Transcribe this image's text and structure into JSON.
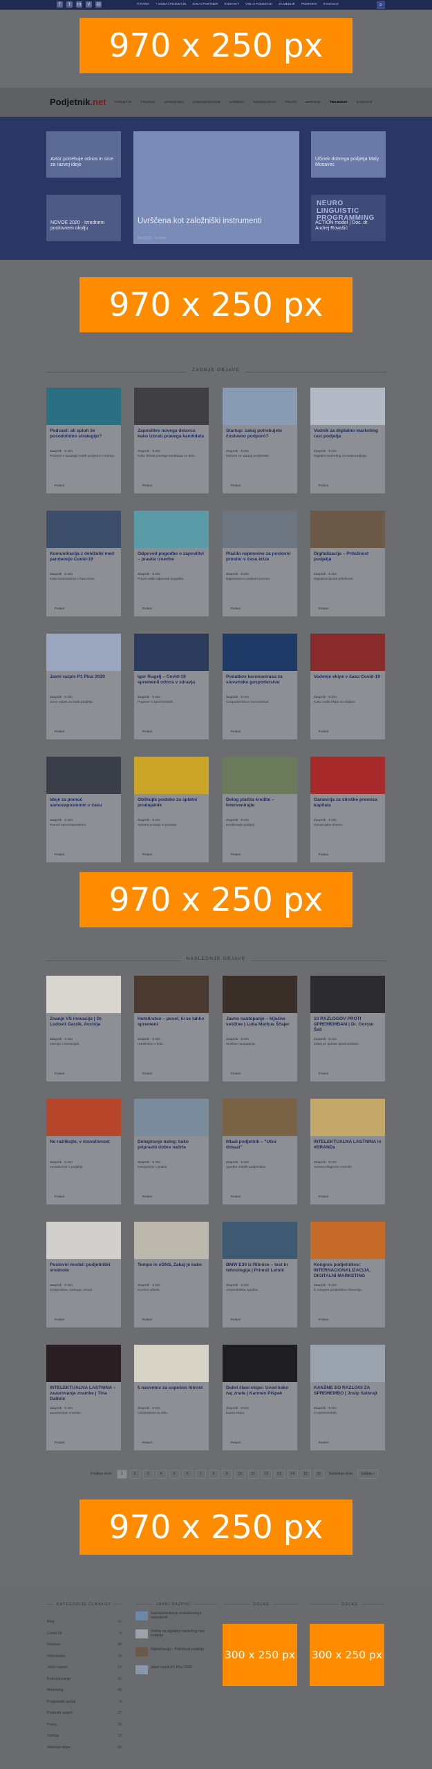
{
  "topbar": {
    "social_icons": [
      "facebook-icon",
      "twitter-icon",
      "linkedin-icon",
      "vimeo-icon",
      "rss-icon"
    ],
    "links": [
      "o nama",
      "+ dodaj podjetje",
      "zakaj partner",
      "kontakt",
      "vse o podjetju",
      "za medije",
      "podpora",
      "e-novice"
    ],
    "search_icon": "search-icon"
  },
  "ads": {
    "top": "970 x 250 px",
    "mid1": "970 x 250 px",
    "mid2": "970 x 250 px",
    "bottom": "970 x 250 px",
    "side1": "300 x 250 px",
    "side2": "300 x 250 px"
  },
  "nav": {
    "logo_main": "Podjetnik",
    "logo_suffix": ".net",
    "menu": [
      "Podjetje",
      "Finance",
      "Marketing",
      "Komuniciranje",
      "Kariera",
      "Tehnologija",
      "Pravo",
      "Zdravje",
      "Trajnost",
      "E-novice"
    ]
  },
  "featured": [
    {
      "title": "Avtor potrebuje odnos in srce za razvoj ideje",
      "meta": "",
      "thumb": "#5c6a96"
    },
    {
      "title": "Uvrščena kot založniški instrumenti",
      "meta": "Maj 2020 · 5 minut",
      "thumb": "#7a8bb8"
    },
    {
      "title": "Učinek dobrega podjetja Maly Mosavec",
      "meta": "",
      "thumb": "#6b7aa8"
    },
    {
      "title": "NOVOE 2020 · Izrednem poslovnem okolju",
      "meta": "",
      "thumb": "#4d5a86"
    },
    {
      "title": "ACTION model | Doc. dr. Andrej Rovašić",
      "meta": "",
      "neuro": "NEURO LINGUISTIC PROGRAMMING",
      "thumb": "#3e4a78"
    }
  ],
  "sections": {
    "latest": "Zadnje objave",
    "recommended": "Naslednje objave"
  },
  "cards_latest": [
    {
      "title": "Podcast: ali sploh še posodobimo strategijo?",
      "meta": "Zaupnik · 5 min",
      "excerpt": "Podcast o strategiji malih podjetij in vodenju.",
      "more": "Preberi",
      "thumb": "#2b6f82"
    },
    {
      "title": "Zaposlitev novega delavca kako izbrati pravega kandidata",
      "meta": "Zaupnik · 5 min",
      "excerpt": "Kako izbrati pravega kandidata za delo.",
      "more": "Preberi",
      "thumb": "#3f3f44"
    },
    {
      "title": "Startup: zakaj potrebujete čustveno podporo?",
      "meta": "Zaupnik · 5 min",
      "excerpt": "Nasveti za startup podjetnike.",
      "more": "Preberi",
      "thumb": "#8a9bb4"
    },
    {
      "title": "Vodnik za digitalno marketing rast podjetja",
      "meta": "Zaupnik · 5 min",
      "excerpt": "Digitalni marketing za mala podjetja.",
      "more": "Preberi",
      "thumb": "#b3bac6"
    },
    {
      "title": "Komunikacija z deležniki med pandemijo Covid-19",
      "meta": "Zaupnik · 5 min",
      "excerpt": "Kako komunicirati v času krize.",
      "more": "Preberi",
      "thumb": "#3d4e6b"
    },
    {
      "title": "Odpoved pogodbe o zaposlitvi – pravila izvedbe",
      "meta": "Zaupnik · 5 min",
      "excerpt": "Pravni vidiki odpovedi pogodbe.",
      "more": "Preberi",
      "thumb": "#5a9ba8"
    },
    {
      "title": "Plačilo najemnine za poslovni prostor v času krize",
      "meta": "Zaupnik · 5 min",
      "excerpt": "Najemnina in poslovni prostor.",
      "more": "Preberi",
      "thumb": "#6c7580"
    },
    {
      "title": "Digitalizacija – Priložnost podjetja",
      "meta": "Zaupnik · 5 min",
      "excerpt": "Digitalizacija kot priložnost.",
      "more": "Preberi",
      "thumb": "#6b5a48"
    },
    {
      "title": "Javni razpis P1 Plus 2020",
      "meta": "Zaupnik · 5 min",
      "excerpt": "Javni razpis za mala podjetja.",
      "more": "Preberi",
      "thumb": "#9aa6bd"
    },
    {
      "title": "Igor Rugelj – Covid-19 spremenil odnos v zdravju",
      "meta": "Zaupnik · 5 min",
      "excerpt": "Pogovor o spremembah.",
      "more": "Preberi",
      "thumb": "#2c3a5c"
    },
    {
      "title": "Podatkov koronavirusa za slovensko gospodarstvo",
      "meta": "Zaupnik · 5 min",
      "excerpt": "Gospodarstvo in koronavirus.",
      "more": "Preberi",
      "thumb": "#1f3a66"
    },
    {
      "title": "Vodenje ekipe v času Covid-19",
      "meta": "Zaupnik · 5 min",
      "excerpt": "Kako voditi ekipo na daljavo.",
      "more": "Preberi",
      "thumb": "#8a2b2b"
    },
    {
      "title": "Ideje za pomoč samozaposlenim v času",
      "meta": "Zaupnik · 5 min",
      "excerpt": "Pomoč samozaposlenim.",
      "more": "Preberi",
      "thumb": "#3a3f4a"
    },
    {
      "title": "Oblikujte podobo za spletni prodajalnik",
      "meta": "Zaupnik · 5 min",
      "excerpt": "Spletna prodaja in podoba.",
      "more": "Preberi",
      "thumb": "#c9a426"
    },
    {
      "title": "Delog plačila kredite – Intervenirajte",
      "meta": "Zaupnik · 5 min",
      "excerpt": "Kreditiranje podjetij.",
      "more": "Preberi",
      "thumb": "#6b7a5a"
    },
    {
      "title": "Garancija za stroške prenosa kapitala",
      "meta": "Zaupnik · 5 min",
      "excerpt": "Garancijske sheme.",
      "more": "Preberi",
      "thumb": "#a82a2a"
    }
  ],
  "cards_recommended": [
    {
      "title": "Znanje VS inovacija | Dr. Ludovit Garzik, Avstrija",
      "meta": "Zaupnik · 5 min",
      "excerpt": "Intervju o inovacijah.",
      "more": "Preberi",
      "thumb": "#d9d6cf"
    },
    {
      "title": "Hotelirstvo – posel, ki se lahko spremeni",
      "meta": "Zaupnik · 5 min",
      "excerpt": "Hotelirstvo v krizi.",
      "more": "Preberi",
      "thumb": "#4a3a30"
    },
    {
      "title": "Javno nastopanje – ključne veščine | Luka Markus Ščajer",
      "meta": "Zaupnik · 5 min",
      "excerpt": "Veščine nastopanja.",
      "more": "Preberi",
      "thumb": "#3a2e28"
    },
    {
      "title": "10 RAZLOGOV PROTI SPREMEMBAM | Dr. Gorran Šeli",
      "meta": "Zaupnik · 5 min",
      "excerpt": "Zakaj se upirate spremembam.",
      "more": "Preberi",
      "thumb": "#2c2c30"
    },
    {
      "title": "Ne razlikujte, v inovativnost",
      "meta": "Zaupnik · 5 min",
      "excerpt": "Inovativnost v podjetju.",
      "more": "Preberi",
      "thumb": "#b7452a"
    },
    {
      "title": "Delegiranje nalog: kako pripraviti dobre načrte",
      "meta": "Zaupnik · 5 min",
      "excerpt": "Delegiranje v praksi.",
      "more": "Preberi",
      "thumb": "#7a8c9c"
    },
    {
      "title": "Mladi podjetnik – \"Učni dokazi\"",
      "meta": "Zaupnik · 5 min",
      "excerpt": "Zgodbe mladih podjetnikov.",
      "more": "Preberi",
      "thumb": "#7a6244"
    },
    {
      "title": "INTELEKTUALNA LASTNINA in #BRANDs",
      "meta": "Zaupnik · 5 min",
      "excerpt": "Varstvo blagovne znamke.",
      "more": "Preberi",
      "thumb": "#c4a86a"
    },
    {
      "title": "Poslovni model: podjetniški vrednote",
      "meta": "Zaupnik · 5 min",
      "excerpt": "Kooperativa, zadruga, zavod.",
      "more": "Preberi",
      "thumb": "#d0cfcb"
    },
    {
      "title": "Tempo in eDNS, Zakaj je kako",
      "meta": "Zaupnik · 5 min",
      "excerpt": "Domino učinek.",
      "more": "Preberi",
      "thumb": "#bdb8ae"
    },
    {
      "title": "BMW E30 iz Ribnice – test in tehnologija | Primož Letnik",
      "meta": "Zaupnik · 5 min",
      "excerpt": "Avtomobilska zgodba.",
      "more": "Preberi",
      "thumb": "#3e5a72"
    },
    {
      "title": "Kongres podjetnikov: INTERNACIONALIZACIJA, DIGITALNI MARKETING",
      "meta": "Zaupnik · 5 min",
      "excerpt": "5. kongres podjetnikov Slovenije.",
      "more": "Preberi",
      "thumb": "#c66a2a"
    },
    {
      "title": "INTELEKTUALNA LASTNINA – zavarovanje znamke | Tina Dalbrić",
      "meta": "Zaupnik · 5 min",
      "excerpt": "Zavarovanje znamke.",
      "more": "Preberi",
      "thumb": "#2a1f22"
    },
    {
      "title": "5 nasvetov za uspešno hitrost",
      "meta": "Zaupnik · 5 min",
      "excerpt": "Učinkovitost na delu.",
      "more": "Preberi",
      "thumb": "#d7d2c6"
    },
    {
      "title": "Dobri člani ekipe: Uvod kako naj znate | Karmen Pišpek",
      "meta": "Zaupnik · 5 min",
      "excerpt": "Dobra ekipa.",
      "more": "Preberi",
      "thumb": "#1e1e22"
    },
    {
      "title": "KAKŠNE SO RAZLOGI ZA SPREMEMBO | Josip Salbrajt",
      "meta": "Zaupnik · 5 min",
      "excerpt": "O spremembah.",
      "more": "Preberi",
      "thumb": "#9aa3ad"
    }
  ],
  "pagination": {
    "prev": "Prejšnja stran",
    "pages": [
      "1",
      "2",
      "3",
      "4",
      "5",
      "6",
      "7",
      "8",
      "9",
      "10",
      "11",
      "12",
      "13",
      "14",
      "15",
      "16"
    ],
    "current": "1",
    "next": "Naslednja stran",
    "last": "Zadnja »"
  },
  "footer": {
    "categories_title": "Kategorije člankov",
    "recent_title": "Javni razpisi",
    "ad_title_1": "Oglas",
    "ad_title_2": "Oglas",
    "categories": [
      {
        "name": "Blog",
        "count": "11"
      },
      {
        "name": "Covid-19",
        "count": "6"
      },
      {
        "name": "Finance",
        "count": "48"
      },
      {
        "name": "Inštruktaže",
        "count": "18"
      },
      {
        "name": "Javni razpisi",
        "count": "14"
      },
      {
        "name": "Komuniciranje",
        "count": "31"
      },
      {
        "name": "Marketing",
        "count": "48"
      },
      {
        "name": "Podjetniški portal",
        "count": "8"
      },
      {
        "name": "Poslovni uspeh",
        "count": "37"
      },
      {
        "name": "Pravo",
        "count": "26"
      },
      {
        "name": "Startup",
        "count": "19"
      },
      {
        "name": "Vodenje ekipe",
        "count": "33"
      }
    ],
    "recent": [
      {
        "title": "Subvencioniranje izobraževanja zaposlenih",
        "thumb": "#6e87a6"
      },
      {
        "title": "Vodnik za digitalno marketing rast podjetja",
        "thumb": "#9ba2aa"
      },
      {
        "title": "Digitalizacija – Priložnost podjetja",
        "thumb": "#6a5a48"
      },
      {
        "title": "Javni razpis P1 Plus 2020",
        "thumb": "#8a96aa"
      }
    ]
  }
}
